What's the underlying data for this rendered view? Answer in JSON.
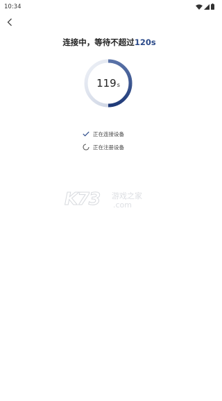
{
  "status_bar": {
    "time": "10:34",
    "icons": [
      "wifi-icon",
      "signal-icon",
      "battery-icon"
    ]
  },
  "header": {
    "back_icon": "chevron-left-icon"
  },
  "title": {
    "prefix": "连接中，等待不超过",
    "highlight": "120s"
  },
  "timer": {
    "value": "119",
    "unit": "s",
    "progress_fraction": 0.01,
    "ring_color": "#2c4b8a"
  },
  "steps": [
    {
      "label": "正在连接设备",
      "status": "done",
      "icon": "check-icon"
    },
    {
      "label": "正在注册设备",
      "status": "loading",
      "icon": "spinner-icon"
    }
  ],
  "watermark": {
    "logo": "K73",
    "text": "游戏之家",
    "domain": ".com"
  },
  "colors": {
    "accent": "#2c4b8a",
    "background": "#ffffff"
  }
}
